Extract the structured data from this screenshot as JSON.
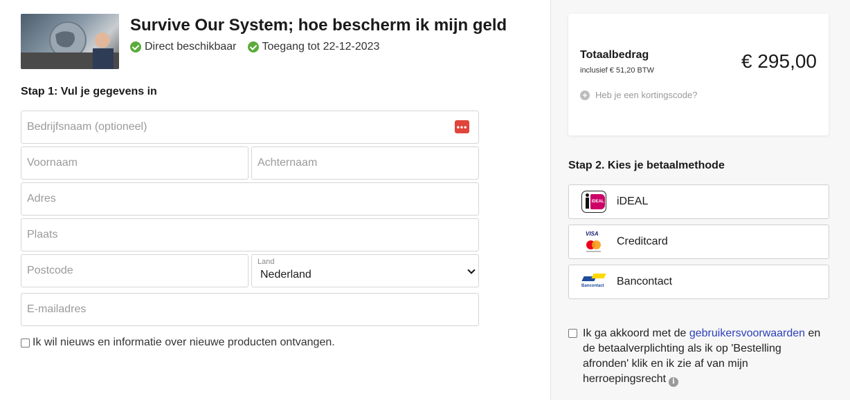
{
  "product": {
    "title": "Survive Our System; hoe bescherm ik mijn geld",
    "badges": [
      "Direct beschikbaar",
      "Toegang tot 22-12-2023"
    ]
  },
  "step1": {
    "title": "Stap 1: Vul je gegevens in",
    "fields": {
      "company": "Bedrijfsnaam (optioneel)",
      "first_name": "Voornaam",
      "last_name": "Achternaam",
      "address": "Adres",
      "city": "Plaats",
      "postcode": "Postcode",
      "email": "E-mailadres"
    },
    "country": {
      "label": "Land",
      "value": "Nederland"
    },
    "newsletter_label": "Ik wil nieuws en informatie over nieuwe producten ontvangen."
  },
  "summary": {
    "total_label": "Totaalbedrag",
    "vat_note": "inclusief € 51,20 BTW",
    "amount": "€ 295,00",
    "coupon_label": "Heb je een kortingscode?"
  },
  "step2": {
    "title": "Stap 2. Kies je betaalmethode",
    "methods": [
      "iDEAL",
      "Creditcard",
      "Bancontact"
    ],
    "icon_texts": {
      "ideal": "iDEAL",
      "visa": "VISA",
      "bancontact": "Bancontact"
    }
  },
  "terms": {
    "prefix": "Ik ga akkoord met de ",
    "link": "gebruikersvoorwaarden",
    "suffix": " en de betaalverplichting als ik op 'Bestelling afronden' klik en ik zie af van mijn herroepingsrecht"
  },
  "colors": {
    "accent_green": "#5cab3b",
    "link_blue": "#2c3fb8",
    "ideal_pink": "#cc0066"
  }
}
